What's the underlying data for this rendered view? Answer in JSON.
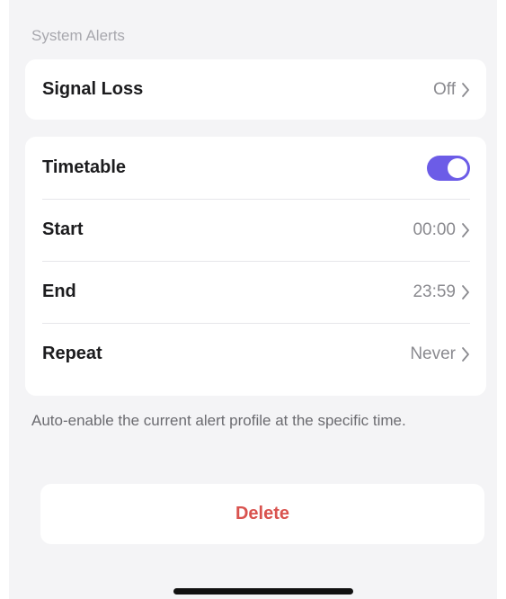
{
  "section": {
    "title": "System Alerts"
  },
  "signal_loss": {
    "label": "Signal Loss",
    "value": "Off"
  },
  "schedule": {
    "timetable": {
      "label": "Timetable",
      "enabled": true,
      "toggle_color": "#6c5ce7"
    },
    "start": {
      "label": "Start",
      "value": "00:00"
    },
    "end": {
      "label": "End",
      "value": "23:59"
    },
    "repeat": {
      "label": "Repeat",
      "value": "Never"
    }
  },
  "footnote": "Auto-enable the current alert profile at the specific time.",
  "actions": {
    "delete_label": "Delete",
    "delete_color": "#d9534f"
  },
  "icons": {
    "row_chevron": "chevron-right-icon"
  }
}
